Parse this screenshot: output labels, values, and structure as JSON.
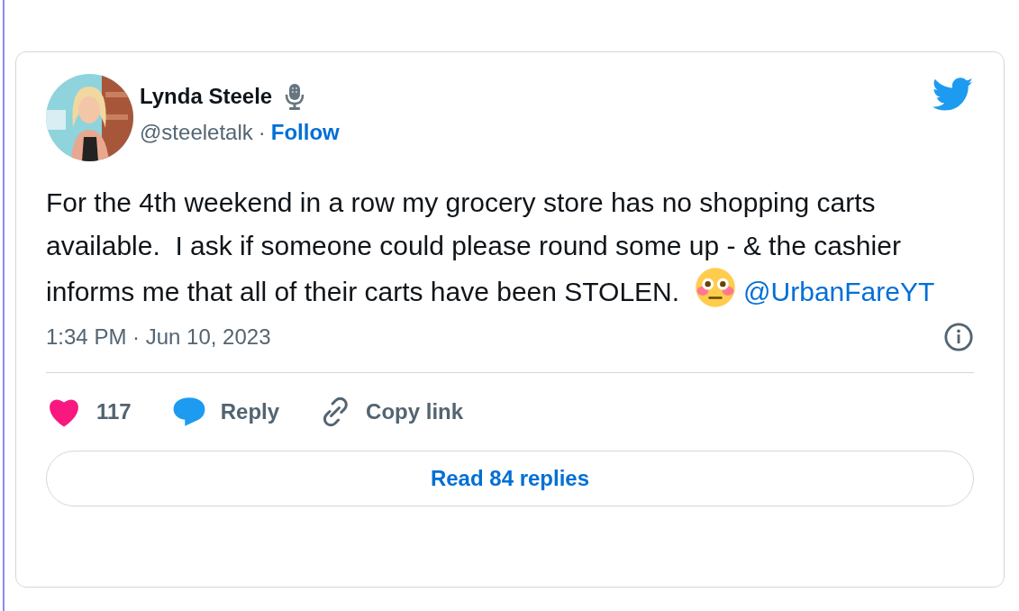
{
  "tweet": {
    "author": {
      "name": "Lynda Steele",
      "handle": "@steeletalk",
      "separator": "·",
      "follow": "Follow"
    },
    "text": "For the 4th weekend in a row my grocery store has no shopping carts available.  I ask if someone could please round some up - & the cashier informs me that all of their carts have been STOLEN.",
    "mention": "@UrbanFareYT",
    "timestamp": "1:34 PM · Jun 10, 2023",
    "actions": [
      {
        "kind": "like",
        "label": "117"
      },
      {
        "kind": "reply",
        "label": "Reply"
      },
      {
        "kind": "copy",
        "label": "Copy link"
      }
    ],
    "read_replies": "Read 84 replies"
  }
}
